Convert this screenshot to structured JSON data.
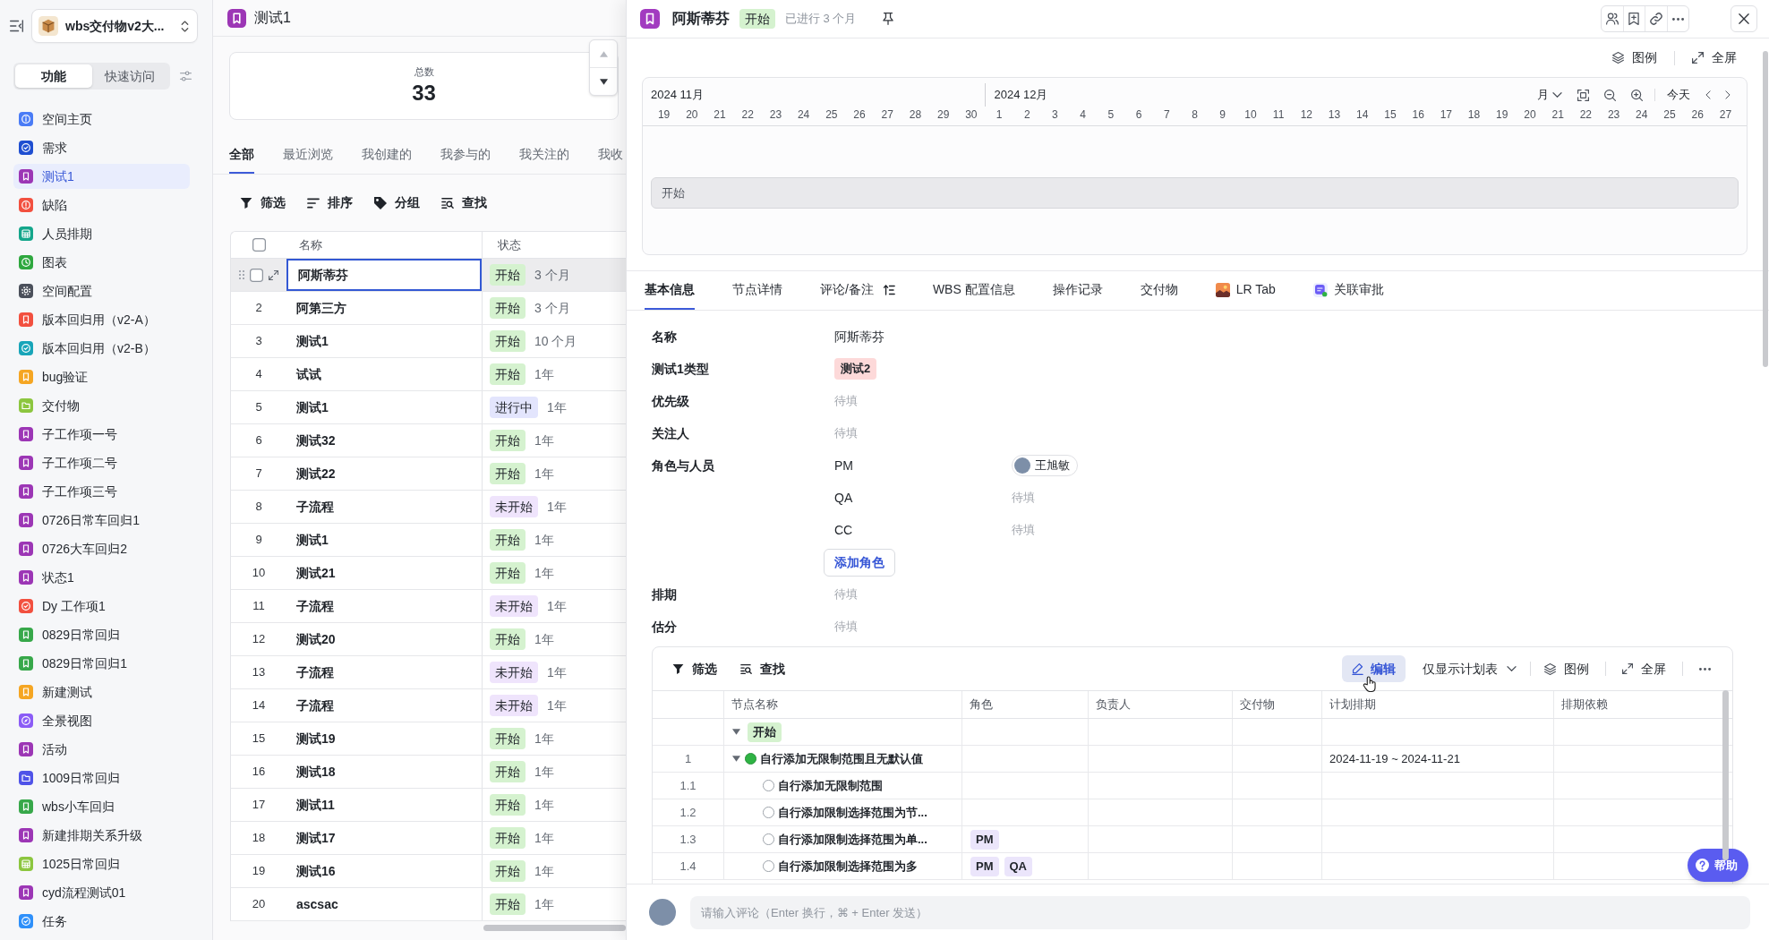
{
  "sidebar": {
    "space": {
      "name": "wbs交付物v2大..."
    },
    "tabs": [
      {
        "label": "功能",
        "selected": true
      },
      {
        "label": "快速访问",
        "selected": false
      }
    ],
    "items": [
      {
        "label": "空间主页",
        "kind": "info",
        "color": "#4a7cf6",
        "selected": false
      },
      {
        "label": "需求",
        "kind": "check",
        "color": "#1f4fd1",
        "selected": false
      },
      {
        "label": "测试1",
        "kind": "bookmark",
        "color": "#9c36b5",
        "selected": true
      },
      {
        "label": "缺陷",
        "kind": "alert",
        "color": "#f2503f",
        "selected": false
      },
      {
        "label": "人员排期",
        "kind": "grid",
        "color": "#14a68b",
        "selected": false
      },
      {
        "label": "图表",
        "kind": "clock",
        "color": "#2fa83f",
        "selected": false
      },
      {
        "label": "空间配置",
        "kind": "gear",
        "color": "#4b505b",
        "selected": false
      },
      {
        "label": "版本回归用（v2-A）",
        "kind": "bookmark",
        "color": "#f2503f",
        "selected": false
      },
      {
        "label": "版本回归用（v2-B）",
        "kind": "check",
        "color": "#18a5b9",
        "selected": false
      },
      {
        "label": "bug验证",
        "kind": "bookmark",
        "color": "#f5a623",
        "selected": false
      },
      {
        "label": "交付物",
        "kind": "folder",
        "color": "#8cc63f",
        "selected": false
      },
      {
        "label": "子工作项一号",
        "kind": "bookmark",
        "color": "#9c36b5",
        "selected": false
      },
      {
        "label": "子工作项二号",
        "kind": "bookmark",
        "color": "#9c36b5",
        "selected": false
      },
      {
        "label": "子工作项三号",
        "kind": "bookmark",
        "color": "#9c36b5",
        "selected": false
      },
      {
        "label": "0726日常车回归1",
        "kind": "bookmark",
        "color": "#9c36b5",
        "selected": false
      },
      {
        "label": "0726大车回归2",
        "kind": "bookmark",
        "color": "#9c36b5",
        "selected": false
      },
      {
        "label": "状态1",
        "kind": "bookmark",
        "color": "#9c36b5",
        "selected": false
      },
      {
        "label": "Dy 工作项1",
        "kind": "check",
        "color": "#f2503f",
        "selected": false
      },
      {
        "label": "0829日常回归",
        "kind": "bookmark",
        "color": "#37a84a",
        "selected": false
      },
      {
        "label": "0829日常回归1",
        "kind": "bookmark",
        "color": "#37a84a",
        "selected": false
      },
      {
        "label": "新建测试",
        "kind": "bookmark",
        "color": "#f5a623",
        "selected": false
      },
      {
        "label": "全景视图",
        "kind": "compass",
        "color": "#8b5cf6",
        "selected": false
      },
      {
        "label": "活动",
        "kind": "bookmark",
        "color": "#9c36b5",
        "selected": false
      },
      {
        "label": "1009日常回归",
        "kind": "folder",
        "color": "#4f53e8",
        "selected": false
      },
      {
        "label": "wbs小车回归",
        "kind": "bookmark",
        "color": "#37a84a",
        "selected": false
      },
      {
        "label": "新建排期关系升级",
        "kind": "bookmark",
        "color": "#9c36b5",
        "selected": false
      },
      {
        "label": "1025日常回归",
        "kind": "grid",
        "color": "#8cc63f",
        "selected": false
      },
      {
        "label": "cyd流程测试01",
        "kind": "bookmark",
        "color": "#9c36b5",
        "selected": false
      },
      {
        "label": "任务",
        "kind": "check",
        "color": "#2e90fa",
        "selected": false
      }
    ]
  },
  "list_panel": {
    "title": "测试1",
    "stat": {
      "label": "总数",
      "value": "33"
    },
    "tabs": [
      {
        "label": "全部",
        "selected": true
      },
      {
        "label": "最近浏览",
        "selected": false
      },
      {
        "label": "我创建的",
        "selected": false
      },
      {
        "label": "我参与的",
        "selected": false
      },
      {
        "label": "我关注的",
        "selected": false
      },
      {
        "label": "我收",
        "selected": false
      }
    ],
    "toolbar": [
      {
        "kind": "filter",
        "label": "筛选"
      },
      {
        "kind": "sort",
        "label": "排序"
      },
      {
        "kind": "group",
        "label": "分组"
      },
      {
        "kind": "find",
        "label": "查找"
      }
    ],
    "table": {
      "select_all": {
        "checked": false
      },
      "columns": [
        "名称",
        "状态"
      ],
      "rows": [
        {
          "selected": true,
          "checked": false,
          "name": "阿斯蒂芬",
          "status": {
            "label": "开始",
            "color": "#d5f2cf"
          },
          "age": "3 个月"
        },
        {
          "selected": false,
          "number": "2",
          "name": "阿第三方",
          "status": {
            "label": "开始",
            "color": "#d5f2cf"
          },
          "age": "3 个月"
        },
        {
          "selected": false,
          "number": "3",
          "name": "测试1",
          "status": {
            "label": "开始",
            "color": "#d5f2cf"
          },
          "age": "10 个月"
        },
        {
          "selected": false,
          "number": "4",
          "name": "试试",
          "status": {
            "label": "开始",
            "color": "#d5f2cf"
          },
          "age": "1年"
        },
        {
          "selected": false,
          "number": "5",
          "name": "测试1",
          "status": {
            "label": "进行中",
            "color": "#e3e5fd"
          },
          "age": "1年"
        },
        {
          "selected": false,
          "number": "6",
          "name": "测试32",
          "status": {
            "label": "开始",
            "color": "#d5f2cf"
          },
          "age": "1年"
        },
        {
          "selected": false,
          "number": "7",
          "name": "测试22",
          "status": {
            "label": "开始",
            "color": "#d5f2cf"
          },
          "age": "1年"
        },
        {
          "selected": false,
          "number": "8",
          "name": "子流程",
          "status": {
            "label": "未开始",
            "color": "#efe4fc"
          },
          "age": "1年"
        },
        {
          "selected": false,
          "number": "9",
          "name": "测试1",
          "status": {
            "label": "开始",
            "color": "#d5f2cf"
          },
          "age": "1年"
        },
        {
          "selected": false,
          "number": "10",
          "name": "测试21",
          "status": {
            "label": "开始",
            "color": "#d5f2cf"
          },
          "age": "1年"
        },
        {
          "selected": false,
          "number": "11",
          "name": "子流程",
          "status": {
            "label": "未开始",
            "color": "#efe4fc"
          },
          "age": "1年"
        },
        {
          "selected": false,
          "number": "12",
          "name": "测试20",
          "status": {
            "label": "开始",
            "color": "#d5f2cf"
          },
          "age": "1年"
        },
        {
          "selected": false,
          "number": "13",
          "name": "子流程",
          "status": {
            "label": "未开始",
            "color": "#efe4fc"
          },
          "age": "1年"
        },
        {
          "selected": false,
          "number": "14",
          "name": "子流程",
          "status": {
            "label": "未开始",
            "color": "#efe4fc"
          },
          "age": "1年"
        },
        {
          "selected": false,
          "number": "15",
          "name": "测试19",
          "status": {
            "label": "开始",
            "color": "#d5f2cf"
          },
          "age": "1年"
        },
        {
          "selected": false,
          "number": "16",
          "name": "测试18",
          "status": {
            "label": "开始",
            "color": "#d5f2cf"
          },
          "age": "1年"
        },
        {
          "selected": false,
          "number": "17",
          "name": "测试11",
          "status": {
            "label": "开始",
            "color": "#d5f2cf"
          },
          "age": "1年"
        },
        {
          "selected": false,
          "number": "18",
          "name": "测试17",
          "status": {
            "label": "开始",
            "color": "#d5f2cf"
          },
          "age": "1年"
        },
        {
          "selected": false,
          "number": "19",
          "name": "测试16",
          "status": {
            "label": "开始",
            "color": "#d5f2cf"
          },
          "age": "1年"
        },
        {
          "selected": false,
          "number": "20",
          "name": "ascsac",
          "status": {
            "label": "开始",
            "color": "#d5f2cf"
          },
          "age": "1年"
        }
      ]
    }
  },
  "detail": {
    "title": "阿斯蒂芬",
    "status": {
      "label": "开始",
      "color": "#d5f2cf"
    },
    "elapsed": "已进行 3 个月",
    "view_actions": [
      {
        "kind": "legend",
        "label": "图例"
      },
      {
        "kind": "fullscreen",
        "label": "全屏"
      }
    ],
    "timeline": {
      "months": [
        {
          "label": "2024 11月",
          "days": [
            "19",
            "20",
            "21",
            "22",
            "23",
            "24",
            "25",
            "26",
            "27",
            "28",
            "29",
            "30"
          ]
        },
        {
          "label": "2024 12月",
          "days": [
            "1",
            "2",
            "3",
            "4",
            "5",
            "6",
            "7",
            "8",
            "9",
            "10",
            "11",
            "12",
            "13",
            "14",
            "15",
            "16",
            "17",
            "18",
            "19",
            "20",
            "21",
            "22",
            "23",
            "24",
            "25",
            "26",
            "27"
          ]
        }
      ],
      "scale": "月",
      "today": "今天",
      "bars": [
        {
          "label": "开始"
        }
      ]
    },
    "tabs": [
      {
        "kind": "plain",
        "label": "基本信息",
        "selected": true
      },
      {
        "kind": "plain",
        "label": "节点详情",
        "selected": false
      },
      {
        "kind": "sort",
        "label": "评论/备注",
        "selected": false
      },
      {
        "kind": "plain",
        "label": "WBS 配置信息",
        "selected": false
      },
      {
        "kind": "plain",
        "label": "操作记录",
        "selected": false
      },
      {
        "kind": "plain",
        "label": "交付物",
        "selected": false
      },
      {
        "kind": "photo",
        "label": "LR Tab",
        "selected": false
      },
      {
        "kind": "app",
        "label": "关联审批",
        "selected": false
      }
    ],
    "fields": [
      {
        "kind": "text",
        "label": "名称",
        "value": "阿斯蒂芬"
      },
      {
        "kind": "tag",
        "label": "测试1类型",
        "value": "测试2",
        "color": "#fdd9d9"
      },
      {
        "kind": "empty",
        "label": "优先级",
        "placeholder": "待填"
      },
      {
        "kind": "empty",
        "label": "关注人",
        "placeholder": "待填"
      },
      {
        "kind": "roles",
        "label": "角色与人员",
        "roles": [
          {
            "role": "PM",
            "person": "王旭敏"
          },
          {
            "role": "QA",
            "placeholder": "待填"
          },
          {
            "role": "CC",
            "placeholder": "待填"
          }
        ],
        "add_button": "添加角色"
      },
      {
        "kind": "empty",
        "label": "排期",
        "placeholder": "待填"
      },
      {
        "kind": "empty",
        "label": "估分",
        "placeholder": "待填"
      }
    ],
    "plan": {
      "toolbar": [
        {
          "kind": "filter",
          "label": "筛选"
        },
        {
          "kind": "find",
          "label": "查找"
        }
      ],
      "edit_button": "编辑",
      "view_select": "仅显示计划表",
      "legend": "图例",
      "fullscreen": "全屏",
      "columns": [
        "节点名称",
        "角色",
        "负责人",
        "交付物",
        "计划排期",
        "排期依赖"
      ],
      "rows": [
        {
          "kind": "group",
          "tag": "开始",
          "color": "#d5f2cf",
          "expanded": true,
          "children": [
            {
              "kind": "node",
              "number": "1",
              "name": "自行添加无限制范围且无默认值",
              "active": true,
              "expanded": true,
              "schedule": "2024-11-19 ~ 2024-11-21",
              "children": [
                {
                  "kind": "node",
                  "number": "1.1",
                  "name": "自行添加无限制范围",
                  "active": false
                },
                {
                  "kind": "node",
                  "number": "1.2",
                  "name": "自行添加限制选择范围为节...",
                  "active": false
                },
                {
                  "kind": "node",
                  "number": "1.3",
                  "name": "自行添加限制选择范围为单...",
                  "active": false,
                  "roles": [
                    "PM"
                  ]
                },
                {
                  "kind": "node",
                  "number": "1.4",
                  "name": "自行添加限制选择范围为多",
                  "active": false,
                  "roles": [
                    "PM",
                    "QA"
                  ]
                }
              ]
            }
          ]
        }
      ]
    },
    "comment": {
      "placeholder": "请输入评论（Enter 换行，⌘ + Enter 发送）"
    },
    "help_button": "帮助"
  }
}
